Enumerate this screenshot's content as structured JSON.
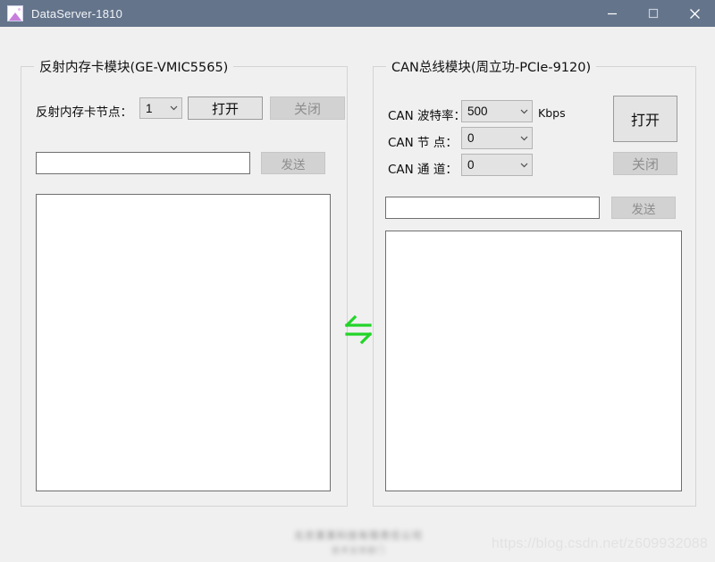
{
  "window": {
    "title": "DataServer-1810",
    "icon": "picture-icon",
    "titlebar_color": "#64748b",
    "body_color": "#f0f0f0",
    "controls": {
      "minimize": "minimize-icon",
      "maximize": "maximize-icon",
      "close": "close-icon"
    }
  },
  "left_panel": {
    "title": "反射内存卡模块(GE-VMIC5565)",
    "node_label": "反射内存卡节点：",
    "node_value": "1",
    "node_options": [
      "1"
    ],
    "open_button": "打开",
    "close_button": "关闭",
    "send_input_value": "",
    "send_input_placeholder": "",
    "send_button": "发送",
    "log_value": ""
  },
  "right_panel": {
    "title": "CAN总线模块(周立功-PCIe-9120)",
    "baud_label": "CAN 波特率：",
    "baud_value": "500",
    "baud_unit": "Kbps",
    "baud_options": [
      "500"
    ],
    "node_label": "CAN 节  点：",
    "node_value": "0",
    "node_options": [
      "0"
    ],
    "channel_label": "CAN 通  道：",
    "channel_value": "0",
    "channel_options": [
      "0"
    ],
    "open_button": "打开",
    "close_button": "关闭",
    "send_input_value": "",
    "send_input_placeholder": "",
    "send_button": "发送",
    "log_value": ""
  },
  "center": {
    "icon": "exchange-arrows-icon",
    "color": "#22d428"
  },
  "footer": {
    "company_line1": "北京某某科技有限责任公司",
    "company_line2": "技术支持部门",
    "csdn_watermark": "https://blog.csdn.net/z609932088"
  }
}
